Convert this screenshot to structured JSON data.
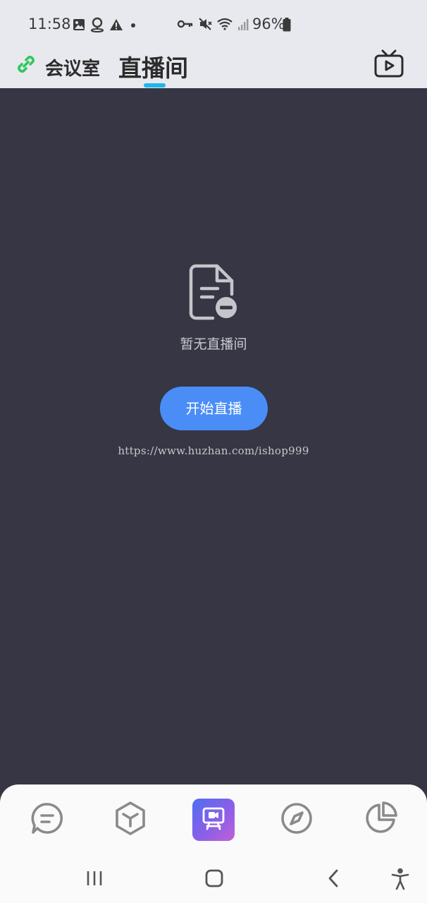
{
  "status_bar": {
    "time": "11:58",
    "battery": "96%",
    "icons_left": [
      "image-icon",
      "location-icon",
      "warning-icon",
      "dot-icon"
    ],
    "icons_right": [
      "key-icon",
      "mute-icon",
      "wifi-icon",
      "signal-icon",
      "battery-icon"
    ]
  },
  "header": {
    "link_icon": "link-icon",
    "tabs": [
      {
        "label": "会议室",
        "active": false
      },
      {
        "label": "直播间",
        "active": true
      }
    ],
    "tv_icon": "tv-play-icon",
    "accent_color": "#1fb6ee",
    "link_icon_color": "#2dc75e"
  },
  "main": {
    "empty_icon": "document-minus-icon",
    "empty_text": "暂无直播间",
    "start_button_label": "开始直播",
    "start_button_color": "#4a8df6",
    "watermark": "https://www.huzhan.com/ishop999",
    "background_color": "#363645"
  },
  "bottom_nav": {
    "items": [
      {
        "icon": "chat-icon",
        "active": false
      },
      {
        "icon": "cube-icon",
        "active": false
      },
      {
        "icon": "live-presentation-icon",
        "active": true
      },
      {
        "icon": "compass-icon",
        "active": false
      },
      {
        "icon": "pie-chart-icon",
        "active": false
      }
    ]
  },
  "system_nav": {
    "buttons": [
      "recent-apps-icon",
      "home-icon",
      "back-icon",
      "accessibility-icon"
    ]
  }
}
